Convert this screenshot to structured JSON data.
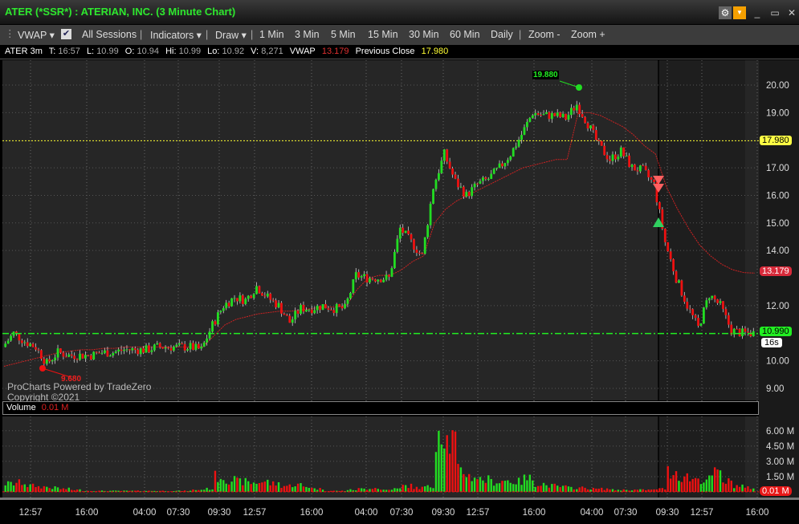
{
  "window": {
    "title": "ATER (*SSR*) : ATERIAN, INC. (3 Minute Chart)"
  },
  "toolbar": {
    "vwap": "VWAP ▾",
    "all_sessions": "All Sessions",
    "indicators": "Indicators ▾",
    "draw": "Draw ▾",
    "intervals": [
      "1 Min",
      "3 Min",
      "5 Min",
      "15 Min",
      "30 Min",
      "60 Min",
      "Daily"
    ],
    "zoom_out": "Zoom -",
    "zoom_in": "Zoom +",
    "all_sessions_checked": true
  },
  "info": {
    "symbol": "ATER 3m",
    "t_label": "T:",
    "t": "16:57",
    "l_label": "L:",
    "l": "10.99",
    "o_label": "O:",
    "o": "10.94",
    "hi_label": "Hi:",
    "hi": "10.99",
    "lo_label": "Lo:",
    "lo": "10.92",
    "v_label": "V:",
    "v": "8,271",
    "vwap_label": "VWAP",
    "vwap": "13.179",
    "prev_label": "Previous Close",
    "prev": "17.980"
  },
  "watermark": {
    "line1": "ProCharts Powered by TradeZero",
    "line2": "Copyright ©2021"
  },
  "volume_header": {
    "label": "Volume",
    "value": "0.01 M"
  },
  "markers": {
    "high": "19.880",
    "low": "9.680",
    "last": "10.990",
    "vwap_tag": "13.179",
    "prev_tag": "17.980",
    "countdown": "16s",
    "volume_tag": "0.01 M"
  },
  "colors": {
    "up": "#22dd22",
    "down": "#ee1111",
    "vwap": "#cc2222",
    "prev": "#ffff33",
    "last": "#22ee22"
  },
  "chart_data": {
    "type": "candlestick",
    "price_ticks": [
      "20.00",
      "19.00",
      "17.00",
      "16.00",
      "15.00",
      "14.00",
      "12.00",
      "10.00",
      "9.00"
    ],
    "price_tick_values": [
      20,
      19,
      17,
      16,
      15,
      14,
      12,
      10,
      9
    ],
    "ylim": [
      9,
      20
    ],
    "volume_ticks": [
      "6.00 M",
      "4.50 M",
      "3.00 M",
      "1.50 M"
    ],
    "volume_tick_values": [
      6,
      4.5,
      3,
      1.5
    ],
    "time_ticks": [
      "12:57",
      "16:00",
      "04:00",
      "07:30",
      "09:30",
      "12:57",
      "16:00",
      "04:00",
      "07:30",
      "09:30",
      "12:57",
      "16:00",
      "04:00",
      "07:30",
      "09:30",
      "12:57",
      "16:00"
    ],
    "closes": [
      10.5,
      11.0,
      10.7,
      10.5,
      9.9,
      10.3,
      10.2,
      10.2,
      10.2,
      10.3,
      10.3,
      10.4,
      10.4,
      10.4,
      10.5,
      10.5,
      10.5,
      10.5,
      10.4,
      11.3,
      12.0,
      12.3,
      12.2,
      12.7,
      12.3,
      12.0,
      11.4,
      11.9,
      11.9,
      12.0,
      11.9,
      11.9,
      13.1,
      13.0,
      13.0,
      13.0,
      14.8,
      14.3,
      13.8,
      16.3,
      17.5,
      16.5,
      16.0,
      16.4,
      16.6,
      17.0,
      17.5,
      18.2,
      19.0,
      18.9,
      18.9,
      18.8,
      19.3,
      18.6,
      17.8,
      17.3,
      17.6,
      17.0,
      16.9,
      16.4,
      14.3,
      13.0,
      12.0,
      11.2,
      12.4,
      12.0,
      11.1,
      11.0,
      11.0
    ],
    "vwap": [
      9.8,
      9.9,
      10.0,
      10.1,
      10.2,
      10.3,
      10.35,
      10.4,
      10.4,
      10.45,
      10.45,
      10.5,
      10.5,
      10.5,
      10.5,
      10.5,
      10.5,
      10.5,
      10.5,
      10.9,
      11.3,
      11.5,
      11.6,
      11.7,
      11.75,
      11.8,
      11.8,
      11.85,
      11.9,
      11.95,
      11.95,
      12.0,
      12.6,
      13.0,
      13.1,
      13.1,
      13.3,
      13.6,
      13.8,
      15.0,
      15.5,
      15.8,
      16.0,
      16.2,
      16.4,
      16.6,
      16.8,
      17.0,
      17.1,
      17.2,
      17.3,
      17.3,
      19.0,
      19.0,
      18.9,
      18.7,
      18.5,
      18.2,
      17.8,
      17.5,
      16.3,
      15.5,
      14.8,
      14.2,
      13.8,
      13.5,
      13.3,
      13.2,
      13.18
    ],
    "volume": [
      0.8,
      0.9,
      0.6,
      0.5,
      0.4,
      0.3,
      0.2,
      0.1,
      0.1,
      0.1,
      0.1,
      0.1,
      0.1,
      0.1,
      0.1,
      0.1,
      0.1,
      0.2,
      0.3,
      1.5,
      1.2,
      1.0,
      0.9,
      1.0,
      0.8,
      0.6,
      0.7,
      0.5,
      0.3,
      0.1,
      0.1,
      0.2,
      0.3,
      0.4,
      0.2,
      0.3,
      0.6,
      0.4,
      0.5,
      6.5,
      5.0,
      2.0,
      1.5,
      1.2,
      1.0,
      1.1,
      1.0,
      1.3,
      0.8,
      0.6,
      0.5,
      0.4,
      0.4,
      0.3,
      0.3,
      0.2,
      0.2,
      0.2,
      0.2,
      0.3,
      2.0,
      1.5,
      1.3,
      1.2,
      1.8,
      1.0,
      0.6,
      0.4,
      0.3
    ]
  }
}
